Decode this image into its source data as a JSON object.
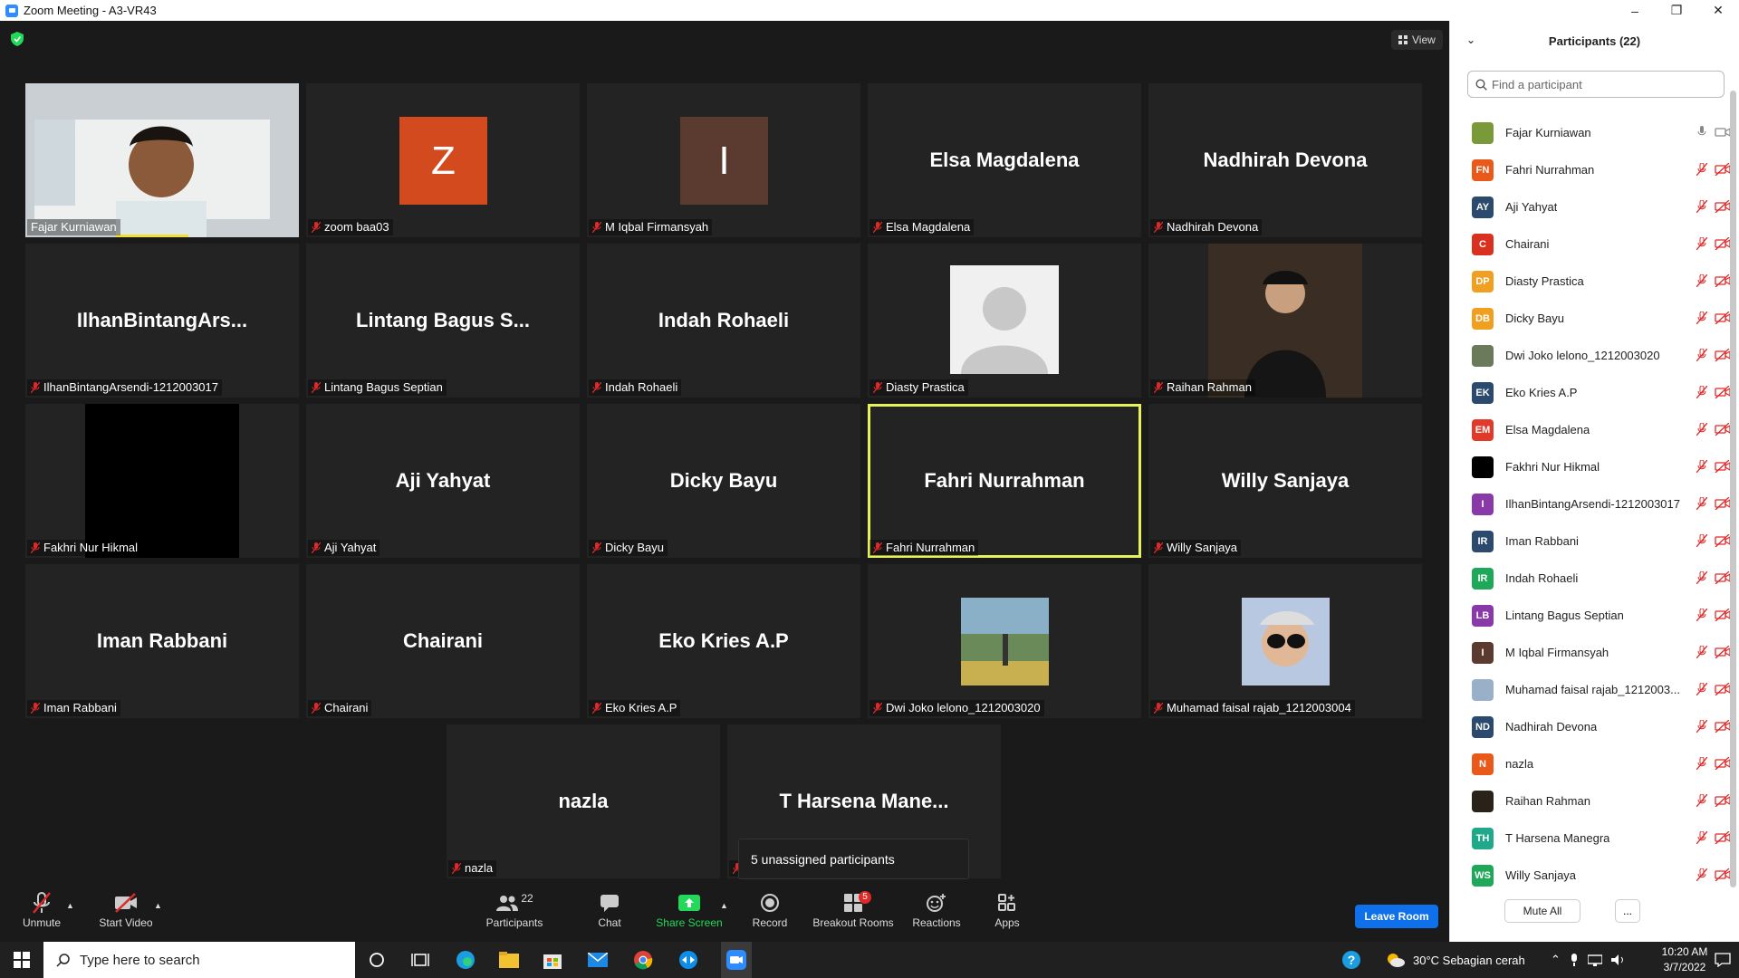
{
  "window": {
    "title": "Zoom Meeting - A3-VR43"
  },
  "view_button": "View",
  "tiles": [
    {
      "big": "",
      "label": "Fajar Kurniawan",
      "muted": false,
      "kind": "video"
    },
    {
      "big": "",
      "label": "zoom baa03",
      "muted": true,
      "kind": "avatar",
      "letter": "Z",
      "color": "#d24a1d"
    },
    {
      "big": "",
      "label": "M Iqbal Firmansyah",
      "muted": true,
      "kind": "avatar",
      "letter": "I",
      "color": "#5b3a30"
    },
    {
      "big": "Elsa Magdalena",
      "label": "Elsa Magdalena",
      "muted": true,
      "kind": "name"
    },
    {
      "big": "Nadhirah Devona",
      "label": "Nadhirah Devona",
      "muted": true,
      "kind": "name"
    },
    {
      "big": "IlhanBintangArs...",
      "label": "IlhanBintangArsendi-1212003017",
      "muted": true,
      "kind": "name"
    },
    {
      "big": "Lintang Bagus S...",
      "label": "Lintang Bagus Septian",
      "muted": true,
      "kind": "name"
    },
    {
      "big": "Indah Rohaeli",
      "label": "Indah Rohaeli",
      "muted": true,
      "kind": "name"
    },
    {
      "big": "",
      "label": "Diasty Prastica",
      "muted": true,
      "kind": "silhouette"
    },
    {
      "big": "",
      "label": "Raihan Rahman",
      "muted": true,
      "kind": "photo-dark"
    },
    {
      "big": "",
      "label": "Fakhri Nur Hikmal",
      "muted": true,
      "kind": "black"
    },
    {
      "big": "Aji Yahyat",
      "label": "Aji Yahyat",
      "muted": true,
      "kind": "name"
    },
    {
      "big": "Dicky Bayu",
      "label": "Dicky Bayu",
      "muted": true,
      "kind": "name"
    },
    {
      "big": "Fahri Nurrahman",
      "label": "Fahri Nurrahman",
      "muted": true,
      "kind": "name",
      "active": true
    },
    {
      "big": "Willy Sanjaya",
      "label": "Willy Sanjaya",
      "muted": true,
      "kind": "name"
    },
    {
      "big": "Iman Rabbani",
      "label": "Iman Rabbani",
      "muted": true,
      "kind": "name"
    },
    {
      "big": "Chairani",
      "label": "Chairani",
      "muted": true,
      "kind": "name"
    },
    {
      "big": "Eko Kries A.P",
      "label": "Eko Kries A.P",
      "muted": true,
      "kind": "name"
    },
    {
      "big": "",
      "label": "Dwi Joko lelono_1212003020",
      "muted": true,
      "kind": "photo-park"
    },
    {
      "big": "",
      "label": "Muhamad faisal rajab_1212003004",
      "muted": true,
      "kind": "photo-sun"
    },
    {
      "big": "nazla",
      "label": "nazla",
      "muted": true,
      "kind": "name"
    },
    {
      "big": "T Harsena Mane...",
      "label": "",
      "muted": true,
      "kind": "name"
    }
  ],
  "unassigned_tooltip": "5 unassigned participants",
  "toolbar": {
    "unmute": "Unmute",
    "start_video": "Start Video",
    "participants": "Participants",
    "participants_count": "22",
    "chat": "Chat",
    "share_screen": "Share Screen",
    "record": "Record",
    "breakout_rooms": "Breakout Rooms",
    "breakout_badge": "5",
    "reactions": "Reactions",
    "apps": "Apps",
    "leave_room": "Leave Room"
  },
  "panel": {
    "title": "Participants (22)",
    "search_placeholder": "Find a participant",
    "mute_all": "Mute All",
    "more": "...",
    "participants": [
      {
        "initials": "",
        "name": "Fajar Kurniawan",
        "color": "#7a9a3a",
        "photo": true,
        "unmuted": true
      },
      {
        "initials": "FN",
        "name": "Fahri Nurrahman",
        "color": "#e8591a"
      },
      {
        "initials": "AY",
        "name": "Aji Yahyat",
        "color": "#2b4a6e"
      },
      {
        "initials": "C",
        "name": "Chairani",
        "color": "#d9301f"
      },
      {
        "initials": "DP",
        "name": "Diasty Prastica",
        "color": "#f0a020"
      },
      {
        "initials": "DB",
        "name": "Dicky Bayu",
        "color": "#f0a020"
      },
      {
        "initials": "",
        "name": "Dwi Joko lelono_1212003020",
        "color": "#6a7a5a",
        "photo": true
      },
      {
        "initials": "EK",
        "name": "Eko Kries A.P",
        "color": "#2b4a6e"
      },
      {
        "initials": "EM",
        "name": "Elsa Magdalena",
        "color": "#e03a2a"
      },
      {
        "initials": "",
        "name": "Fakhri Nur Hikmal",
        "color": "#000000"
      },
      {
        "initials": "I",
        "name": "IlhanBintangArsendi-1212003017",
        "color": "#8a3aa8"
      },
      {
        "initials": "IR",
        "name": "Iman Rabbani",
        "color": "#2b4a6e"
      },
      {
        "initials": "IR",
        "name": "Indah Rohaeli",
        "color": "#1fa85a"
      },
      {
        "initials": "LB",
        "name": "Lintang Bagus Septian",
        "color": "#8a3aa8"
      },
      {
        "initials": "I",
        "name": "M Iqbal Firmansyah",
        "color": "#5b3a30"
      },
      {
        "initials": "",
        "name": "Muhamad faisal rajab_1212003...",
        "color": "#9ab0c8",
        "photo": true
      },
      {
        "initials": "ND",
        "name": "Nadhirah Devona",
        "color": "#2b4a6e"
      },
      {
        "initials": "N",
        "name": "nazla",
        "color": "#e8591a"
      },
      {
        "initials": "",
        "name": "Raihan Rahman",
        "color": "#2a2218",
        "photo": true
      },
      {
        "initials": "TH",
        "name": "T Harsena Manegra",
        "color": "#1fa88a"
      },
      {
        "initials": "WS",
        "name": "Willy Sanjaya",
        "color": "#1fa85a"
      }
    ]
  },
  "taskbar": {
    "search_placeholder": "Type here to search",
    "weather": "30°C  Sebagian cerah",
    "time": "10:20 AM",
    "date": "3/7/2022"
  }
}
